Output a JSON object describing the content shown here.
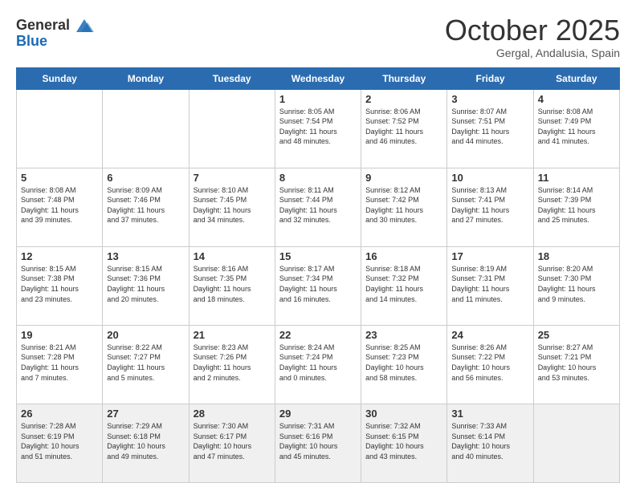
{
  "header": {
    "logo_general": "General",
    "logo_blue": "Blue",
    "month": "October 2025",
    "location": "Gergal, Andalusia, Spain"
  },
  "weekdays": [
    "Sunday",
    "Monday",
    "Tuesday",
    "Wednesday",
    "Thursday",
    "Friday",
    "Saturday"
  ],
  "weeks": [
    [
      {
        "day": "",
        "info": ""
      },
      {
        "day": "",
        "info": ""
      },
      {
        "day": "",
        "info": ""
      },
      {
        "day": "1",
        "info": "Sunrise: 8:05 AM\nSunset: 7:54 PM\nDaylight: 11 hours\nand 48 minutes."
      },
      {
        "day": "2",
        "info": "Sunrise: 8:06 AM\nSunset: 7:52 PM\nDaylight: 11 hours\nand 46 minutes."
      },
      {
        "day": "3",
        "info": "Sunrise: 8:07 AM\nSunset: 7:51 PM\nDaylight: 11 hours\nand 44 minutes."
      },
      {
        "day": "4",
        "info": "Sunrise: 8:08 AM\nSunset: 7:49 PM\nDaylight: 11 hours\nand 41 minutes."
      }
    ],
    [
      {
        "day": "5",
        "info": "Sunrise: 8:08 AM\nSunset: 7:48 PM\nDaylight: 11 hours\nand 39 minutes."
      },
      {
        "day": "6",
        "info": "Sunrise: 8:09 AM\nSunset: 7:46 PM\nDaylight: 11 hours\nand 37 minutes."
      },
      {
        "day": "7",
        "info": "Sunrise: 8:10 AM\nSunset: 7:45 PM\nDaylight: 11 hours\nand 34 minutes."
      },
      {
        "day": "8",
        "info": "Sunrise: 8:11 AM\nSunset: 7:44 PM\nDaylight: 11 hours\nand 32 minutes."
      },
      {
        "day": "9",
        "info": "Sunrise: 8:12 AM\nSunset: 7:42 PM\nDaylight: 11 hours\nand 30 minutes."
      },
      {
        "day": "10",
        "info": "Sunrise: 8:13 AM\nSunset: 7:41 PM\nDaylight: 11 hours\nand 27 minutes."
      },
      {
        "day": "11",
        "info": "Sunrise: 8:14 AM\nSunset: 7:39 PM\nDaylight: 11 hours\nand 25 minutes."
      }
    ],
    [
      {
        "day": "12",
        "info": "Sunrise: 8:15 AM\nSunset: 7:38 PM\nDaylight: 11 hours\nand 23 minutes."
      },
      {
        "day": "13",
        "info": "Sunrise: 8:15 AM\nSunset: 7:36 PM\nDaylight: 11 hours\nand 20 minutes."
      },
      {
        "day": "14",
        "info": "Sunrise: 8:16 AM\nSunset: 7:35 PM\nDaylight: 11 hours\nand 18 minutes."
      },
      {
        "day": "15",
        "info": "Sunrise: 8:17 AM\nSunset: 7:34 PM\nDaylight: 11 hours\nand 16 minutes."
      },
      {
        "day": "16",
        "info": "Sunrise: 8:18 AM\nSunset: 7:32 PM\nDaylight: 11 hours\nand 14 minutes."
      },
      {
        "day": "17",
        "info": "Sunrise: 8:19 AM\nSunset: 7:31 PM\nDaylight: 11 hours\nand 11 minutes."
      },
      {
        "day": "18",
        "info": "Sunrise: 8:20 AM\nSunset: 7:30 PM\nDaylight: 11 hours\nand 9 minutes."
      }
    ],
    [
      {
        "day": "19",
        "info": "Sunrise: 8:21 AM\nSunset: 7:28 PM\nDaylight: 11 hours\nand 7 minutes."
      },
      {
        "day": "20",
        "info": "Sunrise: 8:22 AM\nSunset: 7:27 PM\nDaylight: 11 hours\nand 5 minutes."
      },
      {
        "day": "21",
        "info": "Sunrise: 8:23 AM\nSunset: 7:26 PM\nDaylight: 11 hours\nand 2 minutes."
      },
      {
        "day": "22",
        "info": "Sunrise: 8:24 AM\nSunset: 7:24 PM\nDaylight: 11 hours\nand 0 minutes."
      },
      {
        "day": "23",
        "info": "Sunrise: 8:25 AM\nSunset: 7:23 PM\nDaylight: 10 hours\nand 58 minutes."
      },
      {
        "day": "24",
        "info": "Sunrise: 8:26 AM\nSunset: 7:22 PM\nDaylight: 10 hours\nand 56 minutes."
      },
      {
        "day": "25",
        "info": "Sunrise: 8:27 AM\nSunset: 7:21 PM\nDaylight: 10 hours\nand 53 minutes."
      }
    ],
    [
      {
        "day": "26",
        "info": "Sunrise: 7:28 AM\nSunset: 6:19 PM\nDaylight: 10 hours\nand 51 minutes."
      },
      {
        "day": "27",
        "info": "Sunrise: 7:29 AM\nSunset: 6:18 PM\nDaylight: 10 hours\nand 49 minutes."
      },
      {
        "day": "28",
        "info": "Sunrise: 7:30 AM\nSunset: 6:17 PM\nDaylight: 10 hours\nand 47 minutes."
      },
      {
        "day": "29",
        "info": "Sunrise: 7:31 AM\nSunset: 6:16 PM\nDaylight: 10 hours\nand 45 minutes."
      },
      {
        "day": "30",
        "info": "Sunrise: 7:32 AM\nSunset: 6:15 PM\nDaylight: 10 hours\nand 43 minutes."
      },
      {
        "day": "31",
        "info": "Sunrise: 7:33 AM\nSunset: 6:14 PM\nDaylight: 10 hours\nand 40 minutes."
      },
      {
        "day": "",
        "info": ""
      }
    ]
  ]
}
